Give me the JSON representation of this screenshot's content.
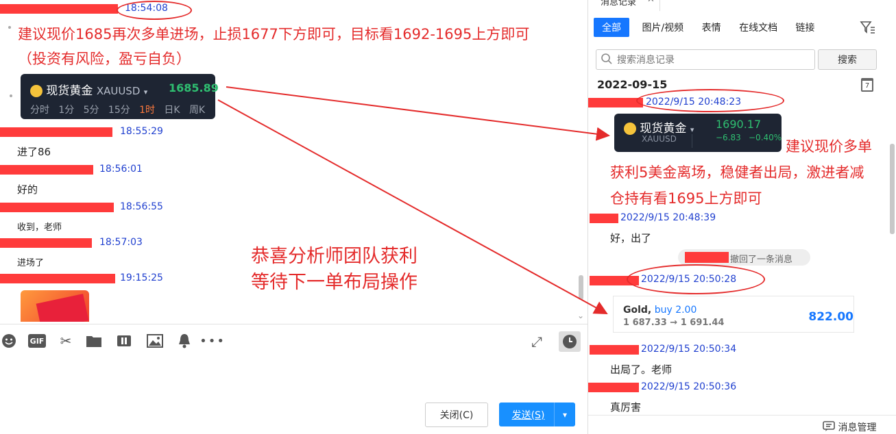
{
  "left_chat": {
    "header_time": "18:54:08",
    "messages": [
      {
        "time": "18:55:29",
        "text": "进了86"
      },
      {
        "time": "18:56:01",
        "text": "好的"
      },
      {
        "time": "18:56:55",
        "text": "收到，老师"
      },
      {
        "time": "18:57:03",
        "text": "进场了"
      },
      {
        "time": "19:15:25",
        "text": ""
      }
    ],
    "advice_line1": "建议现价1685再次多单进场，止损1677下方即可，目标看1692-1695上方即可",
    "advice_line2": "（投资有风险，盈亏自负）",
    "quote_card": {
      "name": "现货黄金",
      "symbol": "XAUUSD",
      "price": "1685.89",
      "intervals": [
        "分时",
        "1分",
        "5分",
        "15分",
        "1时",
        "日K",
        "周K"
      ],
      "active_interval": "1时"
    },
    "annotation_line1": "恭喜分析师团队获利",
    "annotation_line2": "等待下一单布局操作"
  },
  "composer": {
    "close_label": "关闭(C)",
    "send_label": "发送(S)",
    "toolbar_icons": [
      "emoji-icon",
      "gif-icon",
      "scissors-icon",
      "folder-icon",
      "music-icon",
      "image-icon",
      "bell-icon",
      "more-icon"
    ]
  },
  "history_panel": {
    "title": "消息记录",
    "tabs": [
      "全部",
      "图片/视频",
      "表情",
      "在线文档",
      "链接"
    ],
    "active_tab": "全部",
    "search_placeholder": "搜索消息记录",
    "search_button": "搜索",
    "date_header": "2022-09-15",
    "calendar_day": "7",
    "entries": [
      {
        "time": "2022/9/15 20:48:23"
      },
      {
        "time": "2022/9/15 20:48:39",
        "text": "好，出了"
      },
      {
        "time": "2022/9/15 20:50:28"
      },
      {
        "time": "2022/9/15 20:50:34",
        "text": "出局了。老师"
      },
      {
        "time": "2022/9/15 20:50:36",
        "text": "真厉害"
      }
    ],
    "quote_card": {
      "name": "现货黄金",
      "symbol": "XAUUSD",
      "price": "1690.17",
      "change": "−6.83",
      "change_pct": "−0.40%"
    },
    "advice_line1": "建议现价多单",
    "advice_line2": "获利5美金离场，稳健者出局，激进者减",
    "advice_line3": "仓持有看1695上方即可",
    "recall_notice": "撤回了一条消息",
    "trade_card": {
      "instrument": "Gold,",
      "side": "buy 2.00",
      "open_price": "1 687.33",
      "close_price": "1 691.44",
      "profit": "822.00"
    },
    "manage_label": "消息管理"
  },
  "colors": {
    "accent_blue": "#1677ff",
    "annotation_red": "#e42b2b",
    "time_blue": "#1f3fcf",
    "price_green": "#2fbf71"
  }
}
